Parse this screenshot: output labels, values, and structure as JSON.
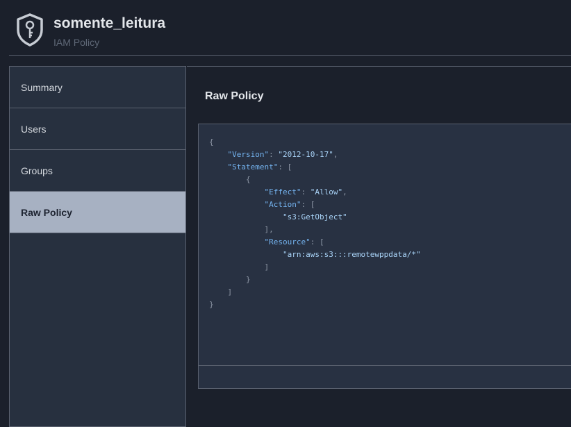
{
  "header": {
    "title": "somente_leitura",
    "subtitle": "IAM Policy"
  },
  "sidebar": {
    "items": [
      {
        "label": "Summary"
      },
      {
        "label": "Users"
      },
      {
        "label": "Groups"
      },
      {
        "label": "Raw Policy",
        "active": true
      }
    ]
  },
  "main": {
    "title": "Raw Policy",
    "policy": {
      "version_key": "\"Version\"",
      "version_value": "\"2012-10-17\"",
      "statement_key": "\"Statement\"",
      "effect_key": "\"Effect\"",
      "effect_value": "\"Allow\"",
      "action_key": "\"Action\"",
      "action_value": "\"s3:GetObject\"",
      "resource_key": "\"Resource\"",
      "resource_value": "\"arn:aws:s3:::remotewppdata/*\""
    }
  },
  "colors": {
    "background": "#1b202b",
    "sidebar": "#27303f",
    "active_item": "#a7b1c2",
    "code_key": "#74b3ef",
    "code_string": "#a9d3f7"
  },
  "icons": {
    "header": "shield-key-icon"
  }
}
